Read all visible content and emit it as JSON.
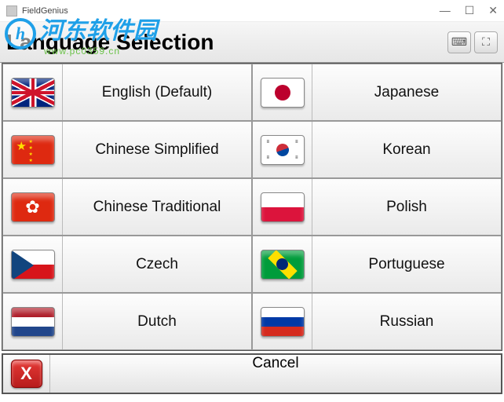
{
  "window": {
    "title": "FieldGenius"
  },
  "watermark": {
    "logo_letter": "h",
    "text": "河东软件园",
    "sub": "www.pc0359.cn"
  },
  "header": {
    "title": "Language Selection"
  },
  "tools": {
    "keyboard_glyph": "⌨",
    "expand_glyph": "⛶"
  },
  "languages": {
    "col1": [
      {
        "label": "English (Default)",
        "flag": "uk"
      },
      {
        "label": "Chinese Simplified",
        "flag": "cn"
      },
      {
        "label": "Chinese Traditional",
        "flag": "hk"
      },
      {
        "label": "Czech",
        "flag": "cz"
      },
      {
        "label": "Dutch",
        "flag": "nl"
      }
    ],
    "col2": [
      {
        "label": "Japanese",
        "flag": "jp"
      },
      {
        "label": "Korean",
        "flag": "kr"
      },
      {
        "label": "Polish",
        "flag": "pl"
      },
      {
        "label": "Portuguese",
        "flag": "br"
      },
      {
        "label": "Russian",
        "flag": "ru"
      }
    ]
  },
  "cancel": {
    "label": "Cancel",
    "glyph": "X"
  }
}
